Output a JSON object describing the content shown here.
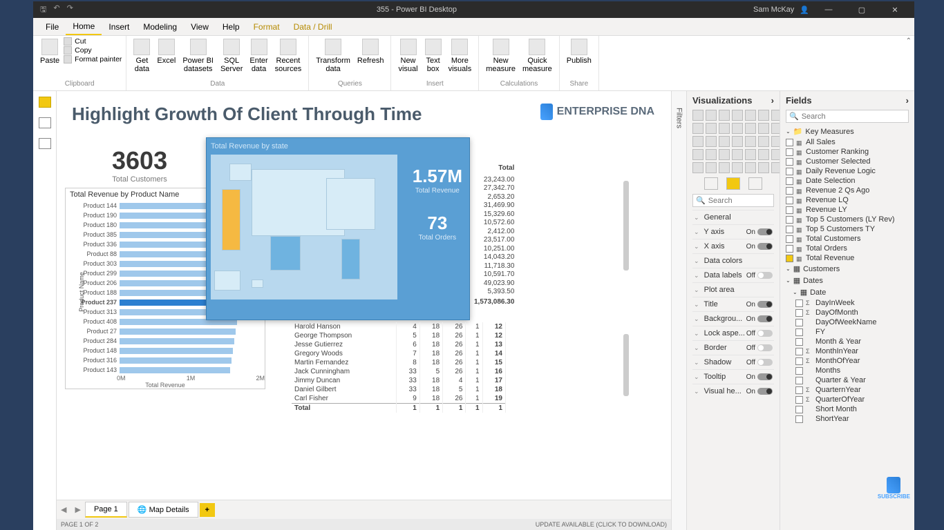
{
  "titlebar": {
    "title": "355 - Power BI Desktop",
    "user": "Sam McKay"
  },
  "menu": {
    "file": "File",
    "home": "Home",
    "insert": "Insert",
    "modeling": "Modeling",
    "view": "View",
    "help": "Help",
    "format": "Format",
    "datadrill": "Data / Drill"
  },
  "ribbon": {
    "clipboard": {
      "paste": "Paste",
      "cut": "Cut",
      "copy": "Copy",
      "painter": "Format painter",
      "label": "Clipboard"
    },
    "data": {
      "getdata": "Get\ndata",
      "excel": "Excel",
      "pbi": "Power BI\ndatasets",
      "sql": "SQL\nServer",
      "enter": "Enter\ndata",
      "recent": "Recent\nsources",
      "label": "Data"
    },
    "queries": {
      "transform": "Transform\ndata",
      "refresh": "Refresh",
      "label": "Queries"
    },
    "insert": {
      "newv": "New\nvisual",
      "textbox": "Text\nbox",
      "more": "More\nvisuals",
      "label": "Insert"
    },
    "calc": {
      "newm": "New\nmeasure",
      "quick": "Quick\nmeasure",
      "label": "Calculations"
    },
    "share": {
      "publish": "Publish",
      "label": "Share"
    }
  },
  "report": {
    "title": "Highlight Growth Of Client Through Time",
    "logo": "ENTERPRISE DNA",
    "kpi_customers": {
      "value": "3603",
      "label": "Total Customers"
    },
    "product_chart": {
      "title": "Total Revenue by Product Name",
      "ylabel": "Product Name",
      "xlabel": "Total Revenue",
      "ticks": [
        "0M",
        "1M",
        "2M"
      ]
    },
    "map": {
      "title": "Total Revenue by state",
      "rev_val": "1.57M",
      "rev_lbl": "Total Revenue",
      "ord_val": "73",
      "ord_lbl": "Total Orders"
    },
    "rvals_header": "Total",
    "rvals": [
      "23,243.00",
      "27,342.70",
      "2,653.20",
      "31,469.90",
      "15,329.60",
      "10,572.60",
      "2,412.00",
      "23,517.00",
      "10,251.00",
      "14,043.20",
      "11,718.30",
      "10,591.70",
      "49,023.90",
      "5,393.50"
    ],
    "rvals_total": "1,573,086.30",
    "table": {
      "rows": [
        [
          "Harold Hanson",
          "4",
          "18",
          "26",
          "1",
          "12"
        ],
        [
          "George Thompson",
          "5",
          "18",
          "26",
          "1",
          "12"
        ],
        [
          "Jesse Gutierrez",
          "6",
          "18",
          "26",
          "1",
          "13"
        ],
        [
          "Gregory Woods",
          "7",
          "18",
          "26",
          "1",
          "14"
        ],
        [
          "Martin Fernandez",
          "8",
          "18",
          "26",
          "1",
          "15"
        ],
        [
          "Jack Cunningham",
          "33",
          "5",
          "26",
          "1",
          "16"
        ],
        [
          "Jimmy Duncan",
          "33",
          "18",
          "4",
          "1",
          "17"
        ],
        [
          "Daniel Gilbert",
          "33",
          "18",
          "5",
          "1",
          "18"
        ],
        [
          "Carl Fisher",
          "9",
          "18",
          "26",
          "1",
          "19"
        ]
      ],
      "total": [
        "Total",
        "1",
        "1",
        "1",
        "1",
        "1"
      ]
    }
  },
  "chart_data": {
    "type": "bar",
    "title": "Total Revenue by Product Name",
    "xlabel": "Total Revenue",
    "ylabel": "Product Name",
    "xlim": [
      0,
      2000000
    ],
    "categories": [
      "Product 144",
      "Product 190",
      "Product 180",
      "Product 385",
      "Product 336",
      "Product 88",
      "Product 303",
      "Product 299",
      "Product 206",
      "Product 188",
      "Product 237",
      "Product 313",
      "Product 408",
      "Product 27",
      "Product 284",
      "Product 148",
      "Product 316",
      "Product 143"
    ],
    "values": [
      1950000,
      1900000,
      1880000,
      1850000,
      1830000,
      1810000,
      1790000,
      1770000,
      1760000,
      1750000,
      1740000,
      1720000,
      1700000,
      1680000,
      1660000,
      1640000,
      1620000,
      1600000
    ],
    "selected_index": 10
  },
  "viz_pane": {
    "header": "Visualizations",
    "search_ph": "Search",
    "sections": {
      "general": "General",
      "yaxis": "Y axis",
      "xaxis": "X axis",
      "datacolors": "Data colors",
      "datalabels": "Data labels",
      "plotarea": "Plot area",
      "title": "Title",
      "background": "Backgrou...",
      "lockaspect": "Lock aspe...",
      "border": "Border",
      "shadow": "Shadow",
      "tooltip": "Tooltip",
      "visualheader": "Visual he..."
    },
    "on": "On",
    "off": "Off"
  },
  "fields_pane": {
    "header": "Fields",
    "search_ph": "Search",
    "groups": {
      "keymeasures": "Key Measures",
      "customers": "Customers",
      "dates": "Dates",
      "date": "Date"
    },
    "kms": [
      "All Sales",
      "Customer Ranking",
      "Customer Selected",
      "Daily Revenue Logic",
      "Date Selection",
      "Revenue 2 Qs Ago",
      "Revenue LQ",
      "Revenue LY",
      "Top 5 Customers (LY Rev)",
      "Top 5 Customers TY",
      "Total Customers",
      "Total Orders",
      "Total Revenue"
    ],
    "datefields": [
      "DayInWeek",
      "DayOfMonth",
      "DayOfWeekName",
      "FY",
      "Month & Year",
      "MonthInYear",
      "MonthOfYear",
      "Months",
      "Quarter & Year",
      "QuarternYear",
      "QuarterOfYear",
      "Short Month",
      "ShortYear"
    ]
  },
  "tabs": {
    "page1": "Page 1",
    "mapdetails": "Map Details"
  },
  "status": {
    "left": "PAGE 1 OF 2",
    "right": "UPDATE AVAILABLE (CLICK TO DOWNLOAD)"
  },
  "filters_label": "Filters",
  "subscribe": "SUBSCRIBE"
}
